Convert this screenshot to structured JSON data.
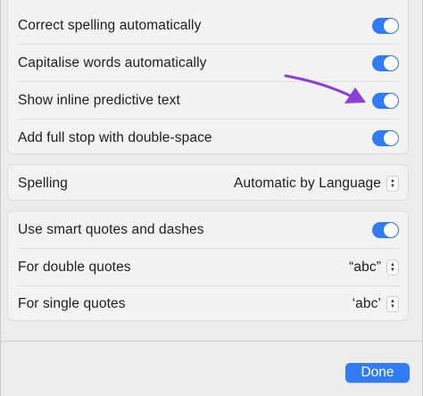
{
  "group1": {
    "items": [
      {
        "label": "Correct spelling automatically",
        "on": true
      },
      {
        "label": "Capitalise words automatically",
        "on": true
      },
      {
        "label": "Show inline predictive text",
        "on": true
      },
      {
        "label": "Add full stop with double-space",
        "on": true
      }
    ]
  },
  "group2": {
    "spelling_label": "Spelling",
    "spelling_value": "Automatic by Language"
  },
  "group3": {
    "smart_quotes_label": "Use smart quotes and dashes",
    "smart_quotes_on": true,
    "double_quotes_label": "For double quotes",
    "double_quotes_value": "“abc”",
    "single_quotes_label": "For single quotes",
    "single_quotes_value": "‘abc’"
  },
  "footer": {
    "done_label": "Done"
  },
  "colors": {
    "accent": "#2f7cf6",
    "annotation_arrow": "#8b3fd6"
  },
  "icons": {
    "stepper": "up-down-chevron-icon",
    "annotation": "purple-arrow-icon"
  }
}
